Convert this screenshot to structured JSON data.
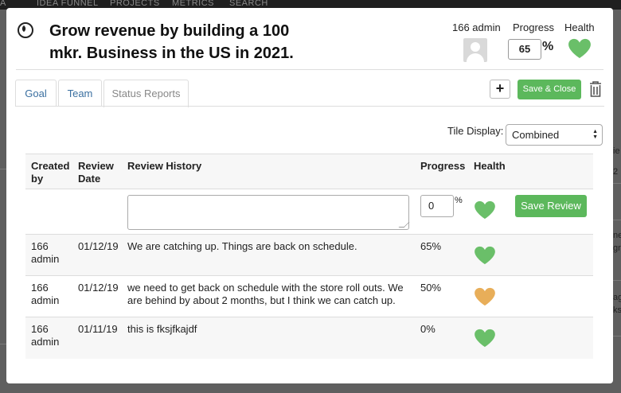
{
  "background": {
    "nav": [
      "A",
      "IDEA FUNNEL",
      "PROJECTS",
      "METRICS",
      "SEARCH"
    ],
    "edge_texts": [
      "ie",
      "2",
      "ne",
      "gra",
      "ag",
      "ks"
    ]
  },
  "modal": {
    "title": "Grow revenue by building a 100 mkr. Business in the US in 2021.",
    "owner_label": "166 admin",
    "progress_label": "Progress",
    "progress_value": "65",
    "progress_unit": "%",
    "health_label": "Health",
    "health_color": "#6abf69",
    "tabs": [
      {
        "label": "Goal",
        "active": false
      },
      {
        "label": "Team",
        "active": false
      },
      {
        "label": "Status Reports",
        "active": true
      }
    ],
    "add_button": "+",
    "save_close_button": "Save & Close",
    "tile_display": {
      "label": "Tile Display:",
      "selected": "Combined"
    },
    "table": {
      "headers": {
        "created_by": "Created by",
        "review_date": "Review Date",
        "review_history": "Review History",
        "progress": "Progress",
        "health": "Health"
      },
      "new_review": {
        "progress_value": "0",
        "progress_unit": "%",
        "health_color": "#6abf69",
        "save_button": "Save Review"
      },
      "rows": [
        {
          "created_by": "166 admin",
          "date": "01/12/19",
          "history": "We are catching up. Things are back on schedule.",
          "progress": "65%",
          "health_color": "#6abf69"
        },
        {
          "created_by": "166 admin",
          "date": "01/12/19",
          "history": "we need to get back on schedule with the store roll outs. We are behind by about 2 months, but I think we can catch up.",
          "progress": "50%",
          "health_color": "#e8ae59"
        },
        {
          "created_by": "166 admin",
          "date": "01/11/19",
          "history": "this is fksjfkajdf",
          "progress": "0%",
          "health_color": "#6abf69"
        }
      ]
    }
  },
  "colors": {
    "accent_green": "#5cb85c",
    "link_blue": "#3a6fa0"
  }
}
